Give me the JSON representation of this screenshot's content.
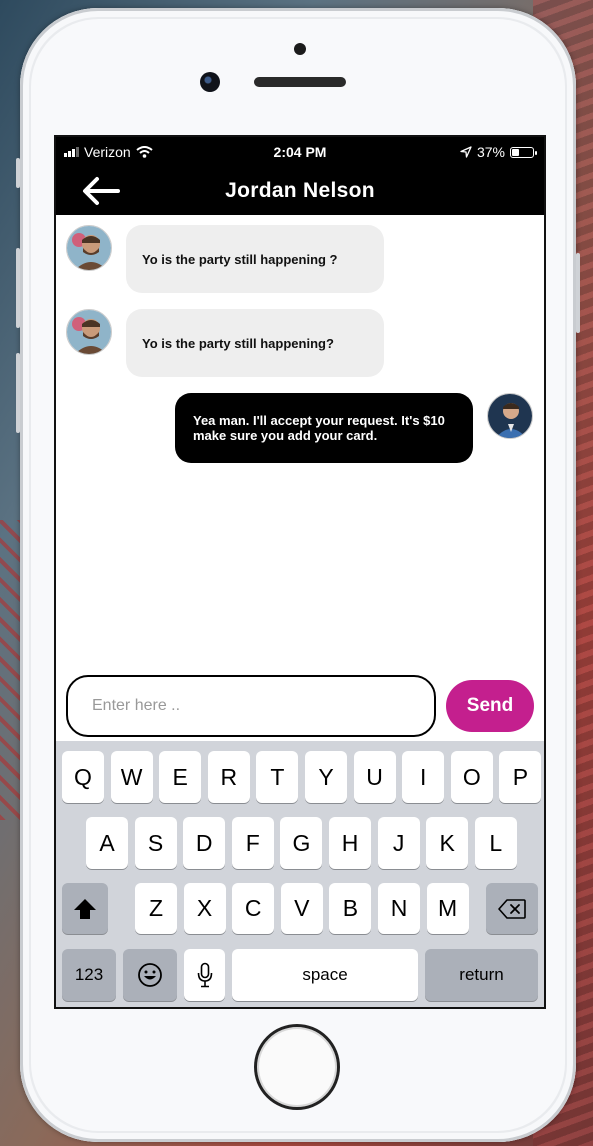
{
  "status_bar": {
    "carrier": "Verizon",
    "time": "2:04 PM",
    "battery": "37%",
    "battery_level": 0.37
  },
  "header": {
    "title": "Jordan Nelson"
  },
  "messages": [
    {
      "from": "contact",
      "text": "Yo is the party still happening ?"
    },
    {
      "from": "contact",
      "text": "Yo is the party still happening?"
    },
    {
      "from": "me",
      "text": "Yea man. I'll accept your request. It's $10 make sure you add your card."
    }
  ],
  "composer": {
    "placeholder": "Enter here ..",
    "value": "",
    "send_label": "Send",
    "send_color": "#c41f8e"
  },
  "keyboard": {
    "row1": [
      "Q",
      "W",
      "E",
      "R",
      "T",
      "Y",
      "U",
      "I",
      "O",
      "P"
    ],
    "row2": [
      "A",
      "S",
      "D",
      "F",
      "G",
      "H",
      "J",
      "K",
      "L"
    ],
    "row3": [
      "Z",
      "X",
      "C",
      "V",
      "B",
      "N",
      "M"
    ],
    "numbers_label": "123",
    "space_label": "space",
    "return_label": "return"
  }
}
